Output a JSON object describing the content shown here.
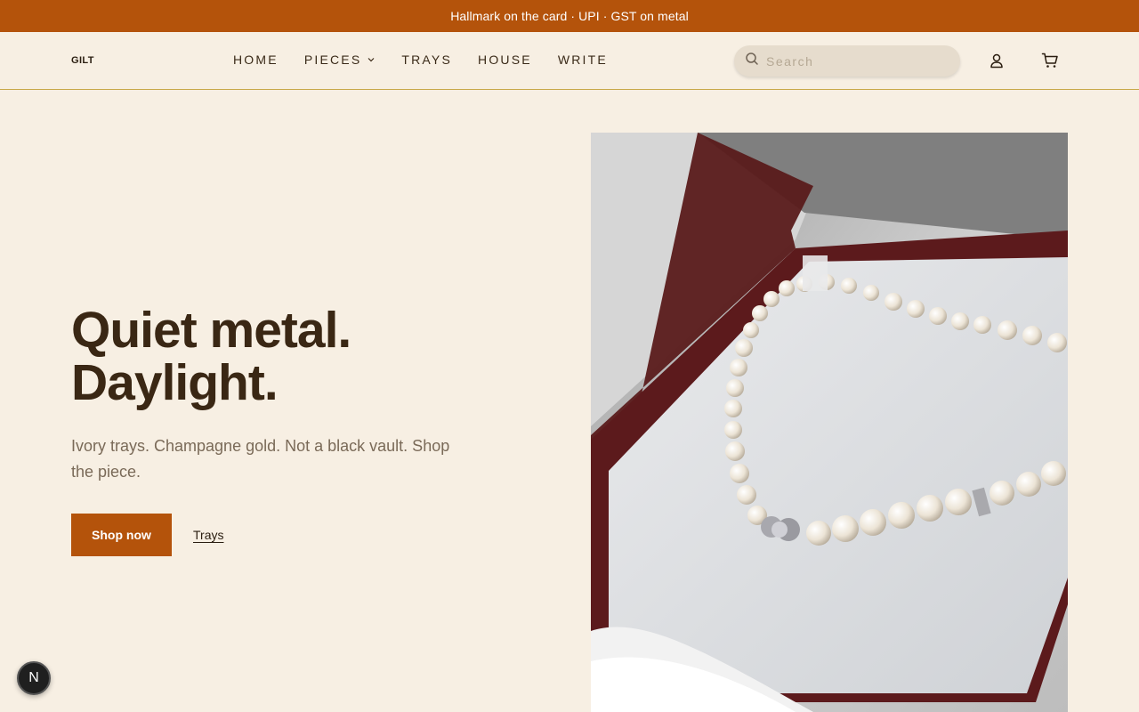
{
  "announcement": "Hallmark on the card · UPI · GST on metal",
  "header": {
    "logo": "GILT",
    "nav": [
      {
        "label": "HOME"
      },
      {
        "label": "PIECES",
        "has_dropdown": true
      },
      {
        "label": "TRAYS"
      },
      {
        "label": "HOUSE"
      },
      {
        "label": "WRITE"
      }
    ],
    "search": {
      "placeholder": "Search",
      "value": ""
    },
    "icons": [
      "search-icon",
      "user-icon",
      "cart-icon",
      "chevron-down-icon"
    ]
  },
  "hero": {
    "title_line1": "Quiet metal.",
    "title_line2": "Daylight.",
    "subtitle": "Ivory trays. Champagne gold. Not a black vault. Shop the piece.",
    "primary_cta": "Shop now",
    "secondary_link": "Trays"
  },
  "dev_badge": "N",
  "colors": {
    "accent": "#b4530b",
    "background": "#f7efe3",
    "heading": "#3a2714",
    "divider": "#c9a84a"
  }
}
